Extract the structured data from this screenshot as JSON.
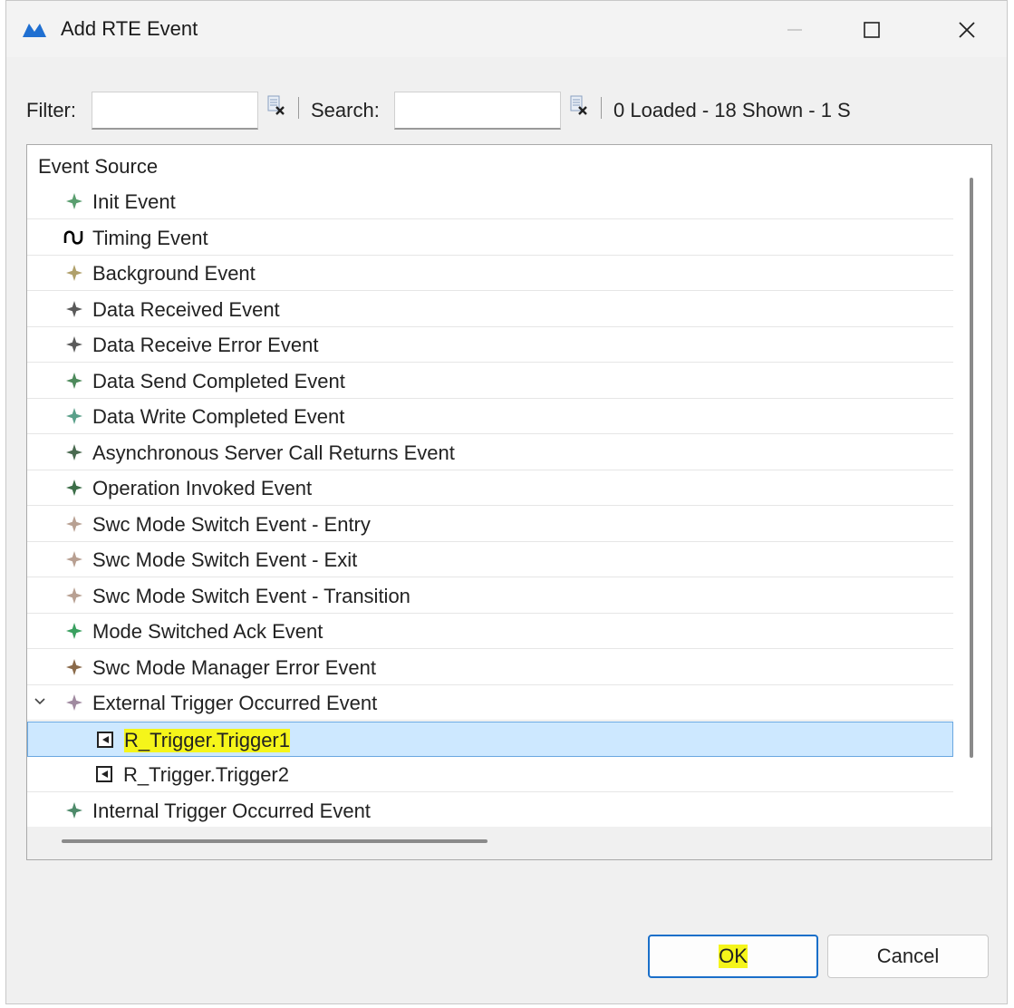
{
  "window": {
    "title": "Add RTE Event",
    "icon": "app-logo-icon"
  },
  "toolbar": {
    "filter_label": "Filter:",
    "filter_value": "",
    "search_label": "Search:",
    "search_value": "",
    "status": "0 Loaded - 18 Shown - 1 S"
  },
  "tree": {
    "header": "Event Source",
    "rows": [
      {
        "label": "Init Event",
        "icon": "event-star-icon",
        "color": "#5a9e6f"
      },
      {
        "label": "Timing Event",
        "icon": "timing-wave-icon",
        "color": "#000000"
      },
      {
        "label": "Background Event",
        "icon": "event-star-icon",
        "color": "#b0a06a"
      },
      {
        "label": "Data Received Event",
        "icon": "event-star-icon",
        "color": "#5a5a5a"
      },
      {
        "label": "Data Receive Error Event",
        "icon": "event-star-icon",
        "color": "#5a5a5a"
      },
      {
        "label": "Data Send Completed Event",
        "icon": "event-star-icon",
        "color": "#4e8a5c"
      },
      {
        "label": "Data Write Completed Event",
        "icon": "event-star-icon",
        "color": "#5aa08a"
      },
      {
        "label": "Asynchronous Server Call Returns Event",
        "icon": "event-star-icon",
        "color": "#4a6a50"
      },
      {
        "label": "Operation Invoked Event",
        "icon": "event-star-icon",
        "color": "#3c6e48"
      },
      {
        "label": "Swc Mode Switch Event - Entry",
        "icon": "event-star-icon",
        "color": "#b8a092"
      },
      {
        "label": "Swc Mode Switch Event - Exit",
        "icon": "event-star-icon",
        "color": "#b8a092"
      },
      {
        "label": "Swc Mode Switch Event - Transition",
        "icon": "event-star-icon",
        "color": "#b8a092"
      },
      {
        "label": "Mode Switched Ack Event",
        "icon": "event-star-icon",
        "color": "#3aa060"
      },
      {
        "label": "Swc Mode Manager Error Event",
        "icon": "event-star-icon",
        "color": "#8a6a4a"
      },
      {
        "label": "External Trigger Occurred Event",
        "icon": "event-star-icon",
        "color": "#a08aa0",
        "expanded": true
      },
      {
        "label": "R_Trigger.Trigger1",
        "icon": "trigger-port-icon",
        "selected": true
      },
      {
        "label": "R_Trigger.Trigger2",
        "icon": "trigger-port-icon"
      },
      {
        "label": "Internal Trigger Occurred Event",
        "icon": "event-star-icon",
        "color": "#4e8a6a"
      }
    ]
  },
  "buttons": {
    "ok": "OK",
    "cancel": "Cancel"
  },
  "colors": {
    "selection": "#cde8ff",
    "highlight": "#f5f51a",
    "accent": "#1a6fc9"
  }
}
